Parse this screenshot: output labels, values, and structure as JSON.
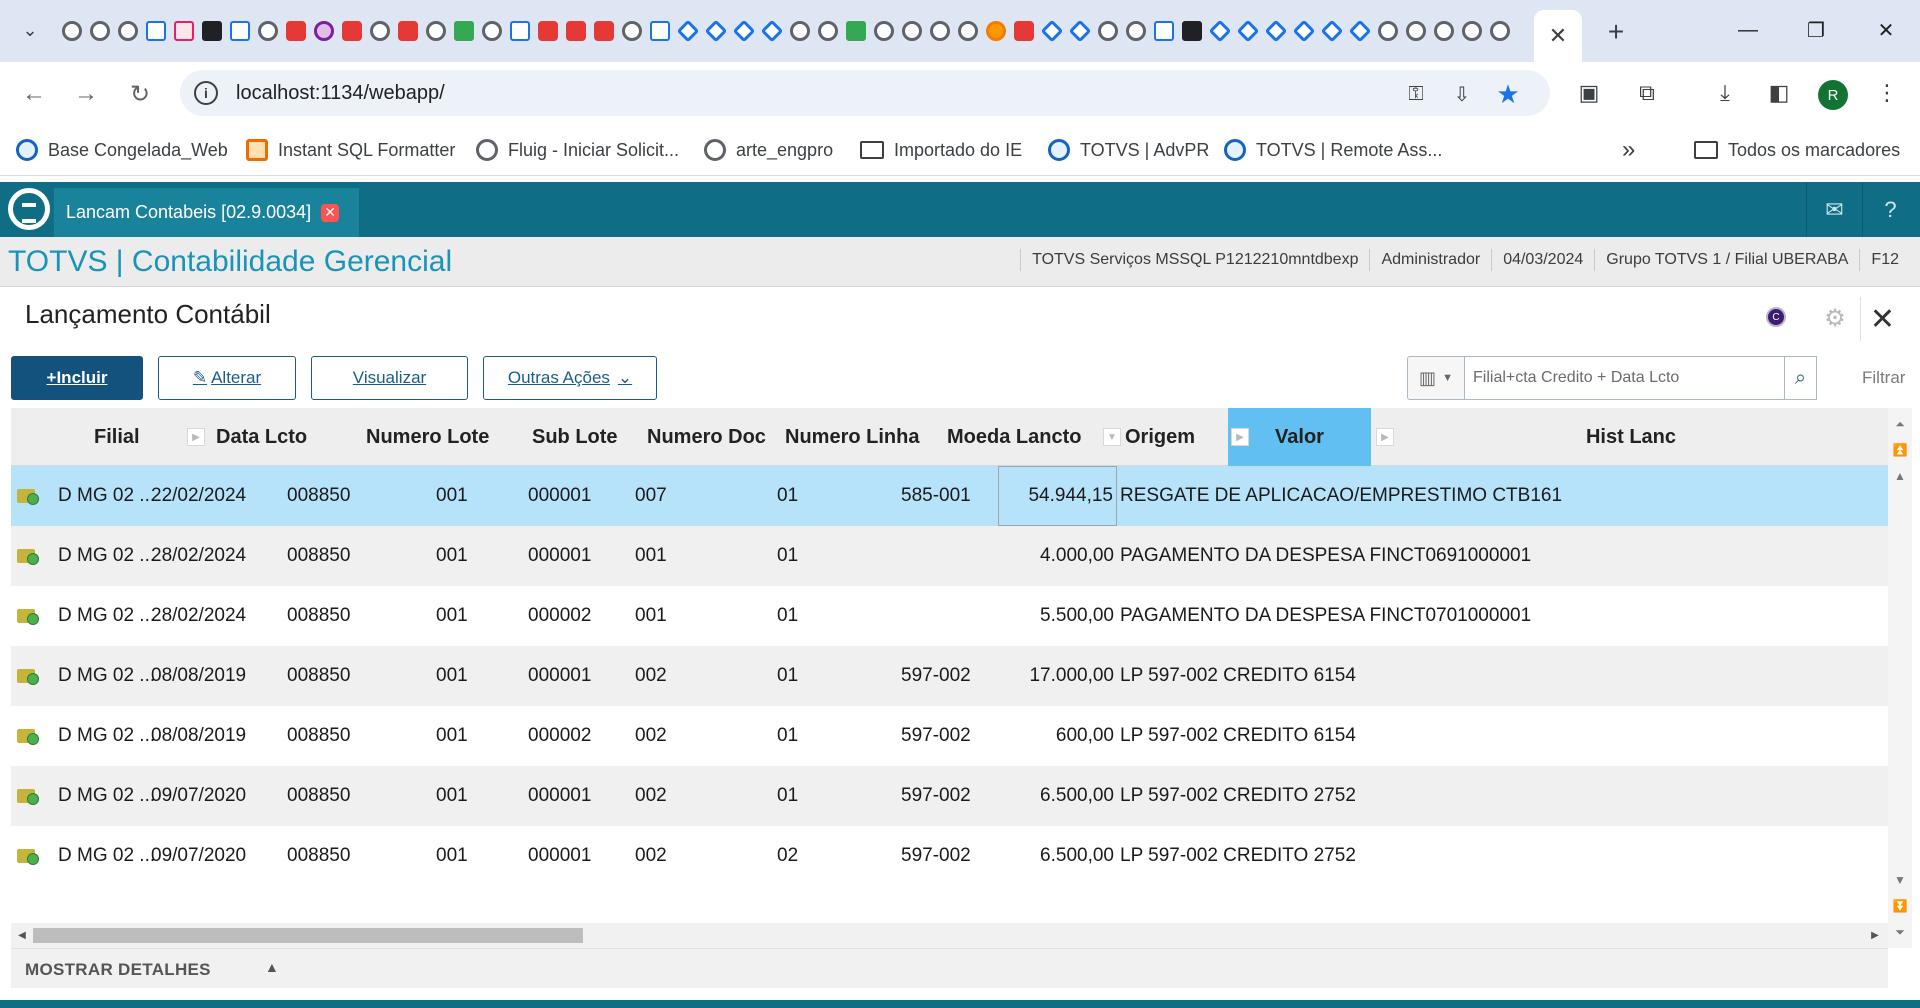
{
  "browser": {
    "active_tab_close": "✕",
    "new_tab": "+",
    "window_controls": {
      "minimize": "—",
      "maximize": "❐",
      "close": "✕"
    },
    "url": "localhost:1134/webapp/",
    "nav": {
      "back": "←",
      "forward": "→",
      "reload": "↻"
    },
    "profile_initial": "R",
    "favicon_count": 52,
    "bookmarks": [
      {
        "label": "Base Congelada_Web",
        "icon": "blue-globe-icon"
      },
      {
        "label": "Instant SQL Formatter",
        "icon": "sql-formatter-icon"
      },
      {
        "label": "Fluig - Iniciar Solicit...",
        "icon": "fluig-icon"
      },
      {
        "label": "arte_engpro",
        "icon": "globe-icon"
      },
      {
        "label": "Importado do IE",
        "icon": "folder-icon"
      },
      {
        "label": "TOTVS | AdvPR",
        "icon": "totvs-icon"
      },
      {
        "label": "TOTVS | Remote Ass...",
        "icon": "totvs-icon"
      }
    ],
    "bookmarks_overflow": "»",
    "all_bookmarks": "Todos os marcadores"
  },
  "app": {
    "tab_label": "Lancam Contabeis [02.9.0034]",
    "tab_close": "✕",
    "module_title": "TOTVS | Contabilidade Gerencial",
    "status": [
      "TOTVS Serviços MSSQL P1212210mntdbexp",
      "Administrador",
      "04/03/2024",
      "Grupo TOTVS 1 / Filial UBERABA",
      "F12"
    ],
    "mail_icon": "✉",
    "help_icon": "?"
  },
  "panel": {
    "title": "Lançamento Contábil",
    "help_badge": "C",
    "gear": "⚙",
    "close": "✕",
    "actions": {
      "incluir": "+Incluir",
      "alterar": "Alterar",
      "visualizar": "Visualizar",
      "outras": "Outras Ações"
    },
    "filter": {
      "placeholder": "Filial+cta Credito + Data Lcto",
      "label": "Filtrar"
    }
  },
  "grid": {
    "columns": {
      "filial": "Filial",
      "data": "Data Lcto",
      "lote": "Numero Lote",
      "sublote": "Sub Lote",
      "doc": "Numero Doc",
      "linha": "Numero Linha",
      "moeda": "Moeda Lancto",
      "origem": "Origem",
      "valor": "Valor",
      "hist": "Hist Lanc"
    },
    "rows": [
      {
        "filial": "D MG 02 ...",
        "data": "22/02/2024",
        "lote": "008850",
        "sublote": "001",
        "doc": "000001",
        "linha": "007",
        "moeda": "01",
        "origem": "585-001",
        "valor": "54.944,15",
        "hist": "RESGATE DE APLICACAO/EMPRESTIMO CTB161"
      },
      {
        "filial": "D MG 02 ...",
        "data": "28/02/2024",
        "lote": "008850",
        "sublote": "001",
        "doc": "000001",
        "linha": "001",
        "moeda": "01",
        "origem": "",
        "valor": "4.000,00",
        "hist": "PAGAMENTO DA DESPESA FINCT0691000001"
      },
      {
        "filial": "D MG 02 ...",
        "data": "28/02/2024",
        "lote": "008850",
        "sublote": "001",
        "doc": "000002",
        "linha": "001",
        "moeda": "01",
        "origem": "",
        "valor": "5.500,00",
        "hist": "PAGAMENTO DA DESPESA FINCT0701000001"
      },
      {
        "filial": "D MG 02 ...",
        "data": "08/08/2019",
        "lote": "008850",
        "sublote": "001",
        "doc": "000001",
        "linha": "002",
        "moeda": "01",
        "origem": "597-002",
        "valor": "17.000,00",
        "hist": "LP 597-002 CREDITO 6154"
      },
      {
        "filial": "D MG 02 ...",
        "data": "08/08/2019",
        "lote": "008850",
        "sublote": "001",
        "doc": "000002",
        "linha": "002",
        "moeda": "01",
        "origem": "597-002",
        "valor": "600,00",
        "hist": "LP 597-002 CREDITO 6154"
      },
      {
        "filial": "D MG 02 ...",
        "data": "09/07/2020",
        "lote": "008850",
        "sublote": "001",
        "doc": "000001",
        "linha": "002",
        "moeda": "01",
        "origem": "597-002",
        "valor": "6.500,00",
        "hist": "LP 597-002 CREDITO 2752"
      },
      {
        "filial": "D MG 02 ...",
        "data": "09/07/2020",
        "lote": "008850",
        "sublote": "001",
        "doc": "000001",
        "linha": "002",
        "moeda": "02",
        "origem": "597-002",
        "valor": "6.500,00",
        "hist": "LP 597-002 CREDITO 2752"
      }
    ],
    "details_toggle": "MOSTRAR DETALHES"
  },
  "colors": {
    "app_bar": "#0f6e86",
    "module_title": "#1a93b8",
    "selected_row": "#b7e3fa",
    "active_header": "#62bff2",
    "primary_button": "#13527d"
  }
}
